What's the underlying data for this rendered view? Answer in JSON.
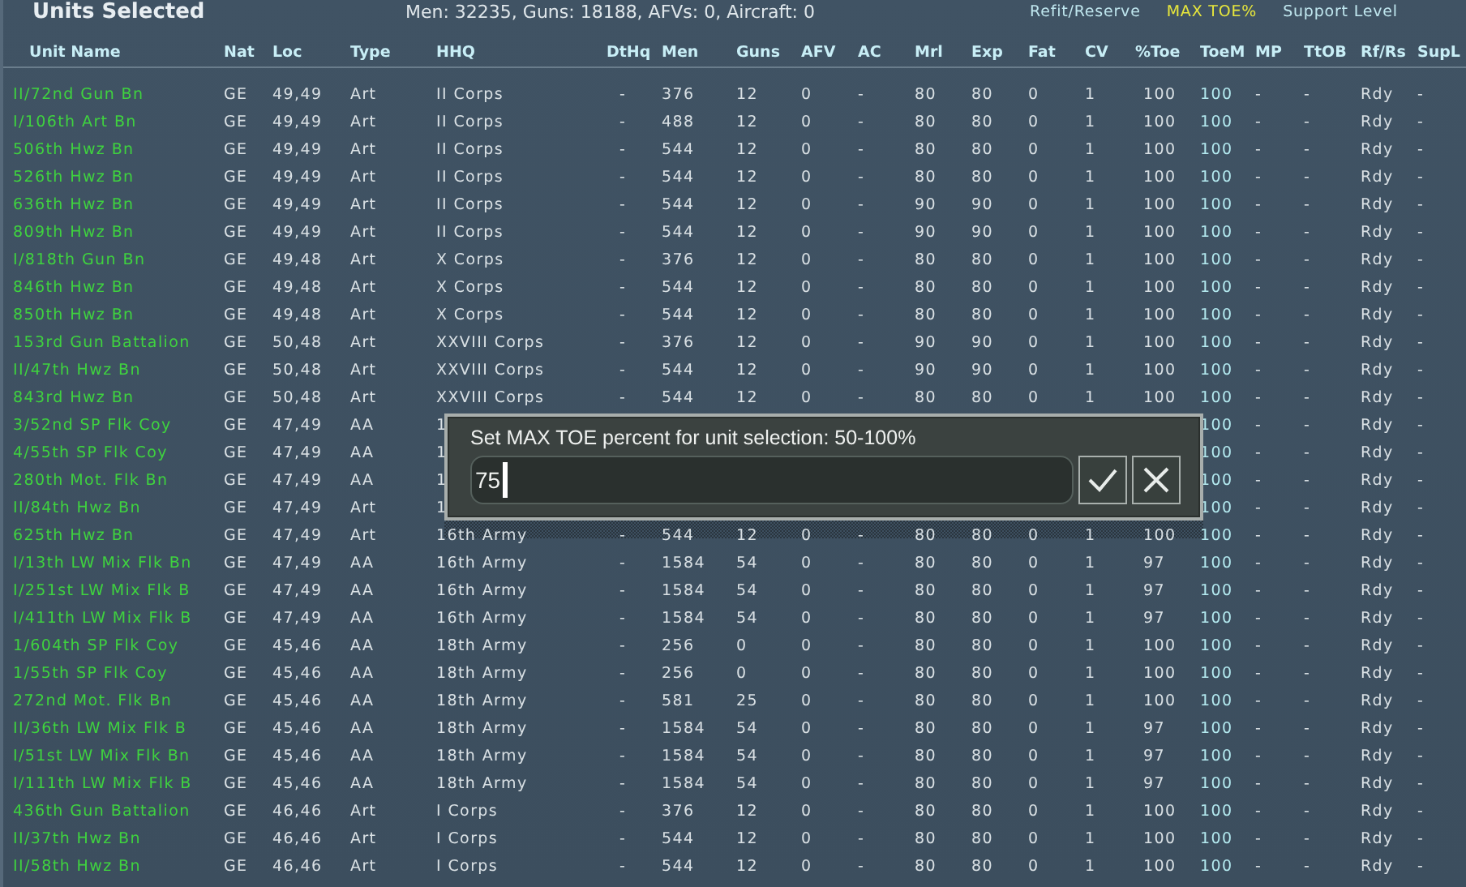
{
  "header": {
    "title": "Units Selected",
    "stats": "Men: 32235, Guns: 18188, AFVs: 0, Aircraft: 0",
    "toggles": [
      {
        "label": "Refit/Reserve",
        "selected": false
      },
      {
        "label": "MAX TOE%",
        "selected": true
      },
      {
        "label": "Support Level",
        "selected": false
      }
    ]
  },
  "table": {
    "columns": [
      "Unit Name",
      "Nat",
      "Loc",
      "Type",
      "HHQ",
      "DtHq",
      "Men",
      "Guns",
      "AFV",
      "AC",
      "Mrl",
      "Exp",
      "Fat",
      "CV",
      "%Toe",
      "ToeM",
      "MP",
      "TtOB",
      "Rf/Rs",
      "SupL"
    ],
    "rows": [
      {
        "cells": [
          "II/72nd Gun Bn",
          "GE",
          "49,49",
          "Art",
          "II Corps",
          "-",
          "376",
          "12",
          "0",
          "-",
          "80",
          "80",
          "0",
          "1",
          "100",
          "100",
          "-",
          "-",
          "Rdy",
          "-"
        ]
      },
      {
        "cells": [
          "I/106th Art Bn",
          "GE",
          "49,49",
          "Art",
          "II Corps",
          "-",
          "488",
          "12",
          "0",
          "-",
          "80",
          "80",
          "0",
          "1",
          "100",
          "100",
          "-",
          "-",
          "Rdy",
          "-"
        ]
      },
      {
        "cells": [
          "506th Hwz Bn",
          "GE",
          "49,49",
          "Art",
          "II Corps",
          "-",
          "544",
          "12",
          "0",
          "-",
          "80",
          "80",
          "0",
          "1",
          "100",
          "100",
          "-",
          "-",
          "Rdy",
          "-"
        ]
      },
      {
        "cells": [
          "526th Hwz Bn",
          "GE",
          "49,49",
          "Art",
          "II Corps",
          "-",
          "544",
          "12",
          "0",
          "-",
          "80",
          "80",
          "0",
          "1",
          "100",
          "100",
          "-",
          "-",
          "Rdy",
          "-"
        ]
      },
      {
        "cells": [
          "636th Hwz Bn",
          "GE",
          "49,49",
          "Art",
          "II Corps",
          "-",
          "544",
          "12",
          "0",
          "-",
          "90",
          "90",
          "0",
          "1",
          "100",
          "100",
          "-",
          "-",
          "Rdy",
          "-"
        ]
      },
      {
        "cells": [
          "809th Hwz Bn",
          "GE",
          "49,49",
          "Art",
          "II Corps",
          "-",
          "544",
          "12",
          "0",
          "-",
          "90",
          "90",
          "0",
          "1",
          "100",
          "100",
          "-",
          "-",
          "Rdy",
          "-"
        ]
      },
      {
        "cells": [
          "I/818th Gun Bn",
          "GE",
          "49,48",
          "Art",
          "X Corps",
          "-",
          "376",
          "12",
          "0",
          "-",
          "80",
          "80",
          "0",
          "1",
          "100",
          "100",
          "-",
          "-",
          "Rdy",
          "-"
        ]
      },
      {
        "cells": [
          "846th Hwz Bn",
          "GE",
          "49,48",
          "Art",
          "X Corps",
          "-",
          "544",
          "12",
          "0",
          "-",
          "80",
          "80",
          "0",
          "1",
          "100",
          "100",
          "-",
          "-",
          "Rdy",
          "-"
        ]
      },
      {
        "cells": [
          "850th Hwz Bn",
          "GE",
          "49,48",
          "Art",
          "X Corps",
          "-",
          "544",
          "12",
          "0",
          "-",
          "80",
          "80",
          "0",
          "1",
          "100",
          "100",
          "-",
          "-",
          "Rdy",
          "-"
        ]
      },
      {
        "cells": [
          "153rd Gun Battalion",
          "GE",
          "50,48",
          "Art",
          "XXVIII Corps",
          "-",
          "376",
          "12",
          "0",
          "-",
          "90",
          "90",
          "0",
          "1",
          "100",
          "100",
          "-",
          "-",
          "Rdy",
          "-"
        ]
      },
      {
        "cells": [
          "II/47th Hwz Bn",
          "GE",
          "50,48",
          "Art",
          "XXVIII Corps",
          "-",
          "544",
          "12",
          "0",
          "-",
          "90",
          "90",
          "0",
          "1",
          "100",
          "100",
          "-",
          "-",
          "Rdy",
          "-"
        ]
      },
      {
        "cells": [
          "843rd Hwz Bn",
          "GE",
          "50,48",
          "Art",
          "XXVIII Corps",
          "-",
          "544",
          "12",
          "0",
          "-",
          "80",
          "80",
          "0",
          "1",
          "100",
          "100",
          "-",
          "-",
          "Rdy",
          "-"
        ]
      },
      {
        "cells": [
          "3/52nd SP Flk Coy",
          "GE",
          "47,49",
          "AA",
          "1"
        ],
        "tail_cells": [
          "100",
          "-",
          "-",
          "Rdy",
          "-"
        ]
      },
      {
        "cells": [
          "4/55th SP Flk Coy",
          "GE",
          "47,49",
          "AA",
          "1"
        ],
        "tail_cells": [
          "100",
          "-",
          "-",
          "Rdy",
          "-"
        ]
      },
      {
        "cells": [
          "280th Mot. Flk Bn",
          "GE",
          "47,49",
          "AA",
          "1"
        ],
        "tail_cells": [
          "100",
          "-",
          "-",
          "Rdy",
          "-"
        ]
      },
      {
        "cells": [
          "II/84th Hwz Bn",
          "GE",
          "47,49",
          "Art",
          "1"
        ],
        "tail_cells": [
          "100",
          "-",
          "-",
          "Rdy",
          "-"
        ]
      },
      {
        "cells": [
          "625th Hwz Bn",
          "GE",
          "47,49",
          "Art",
          "16th Army",
          "-",
          "544",
          "12",
          "0",
          "-",
          "80",
          "80",
          "0",
          "1",
          "100",
          "100",
          "-",
          "-",
          "Rdy",
          "-"
        ]
      },
      {
        "cells": [
          "I/13th LW Mix Flk Bn",
          "GE",
          "47,49",
          "AA",
          "16th Army",
          "-",
          "1584",
          "54",
          "0",
          "-",
          "80",
          "80",
          "0",
          "1",
          "97",
          "100",
          "-",
          "-",
          "Rdy",
          "-"
        ]
      },
      {
        "cells": [
          "I/251st LW Mix Flk B",
          "GE",
          "47,49",
          "AA",
          "16th Army",
          "-",
          "1584",
          "54",
          "0",
          "-",
          "80",
          "80",
          "0",
          "1",
          "97",
          "100",
          "-",
          "-",
          "Rdy",
          "-"
        ]
      },
      {
        "cells": [
          "I/411th LW Mix Flk B",
          "GE",
          "47,49",
          "AA",
          "16th Army",
          "-",
          "1584",
          "54",
          "0",
          "-",
          "80",
          "80",
          "0",
          "1",
          "97",
          "100",
          "-",
          "-",
          "Rdy",
          "-"
        ]
      },
      {
        "cells": [
          "1/604th SP Flk Coy",
          "GE",
          "45,46",
          "AA",
          "18th Army",
          "-",
          "256",
          "0",
          "0",
          "-",
          "80",
          "80",
          "0",
          "1",
          "100",
          "100",
          "-",
          "-",
          "Rdy",
          "-"
        ]
      },
      {
        "cells": [
          "1/55th SP Flk Coy",
          "GE",
          "45,46",
          "AA",
          "18th Army",
          "-",
          "256",
          "0",
          "0",
          "-",
          "80",
          "80",
          "0",
          "1",
          "100",
          "100",
          "-",
          "-",
          "Rdy",
          "-"
        ]
      },
      {
        "cells": [
          "272nd Mot. Flk Bn",
          "GE",
          "45,46",
          "AA",
          "18th Army",
          "-",
          "581",
          "25",
          "0",
          "-",
          "80",
          "80",
          "0",
          "1",
          "100",
          "100",
          "-",
          "-",
          "Rdy",
          "-"
        ]
      },
      {
        "cells": [
          "II/36th LW Mix Flk B",
          "GE",
          "45,46",
          "AA",
          "18th Army",
          "-",
          "1584",
          "54",
          "0",
          "-",
          "80",
          "80",
          "0",
          "1",
          "97",
          "100",
          "-",
          "-",
          "Rdy",
          "-"
        ]
      },
      {
        "cells": [
          "I/51st LW Mix Flk Bn",
          "GE",
          "45,46",
          "AA",
          "18th Army",
          "-",
          "1584",
          "54",
          "0",
          "-",
          "80",
          "80",
          "0",
          "1",
          "97",
          "100",
          "-",
          "-",
          "Rdy",
          "-"
        ]
      },
      {
        "cells": [
          "I/111th LW Mix Flk B",
          "GE",
          "45,46",
          "AA",
          "18th Army",
          "-",
          "1584",
          "54",
          "0",
          "-",
          "80",
          "80",
          "0",
          "1",
          "97",
          "100",
          "-",
          "-",
          "Rdy",
          "-"
        ]
      },
      {
        "cells": [
          "436th Gun Battalion",
          "GE",
          "46,46",
          "Art",
          "I Corps",
          "-",
          "376",
          "12",
          "0",
          "-",
          "80",
          "80",
          "0",
          "1",
          "100",
          "100",
          "-",
          "-",
          "Rdy",
          "-"
        ]
      },
      {
        "cells": [
          "II/37th Hwz Bn",
          "GE",
          "46,46",
          "Art",
          "I Corps",
          "-",
          "544",
          "12",
          "0",
          "-",
          "80",
          "80",
          "0",
          "1",
          "100",
          "100",
          "-",
          "-",
          "Rdy",
          "-"
        ]
      },
      {
        "cells": [
          "II/58th Hwz Bn",
          "GE",
          "46,46",
          "Art",
          "I Corps",
          "-",
          "544",
          "12",
          "0",
          "-",
          "80",
          "80",
          "0",
          "1",
          "100",
          "100",
          "-",
          "-",
          "Rdy",
          "-"
        ]
      }
    ]
  },
  "dialog": {
    "prompt": "Set MAX TOE percent for unit selection: 50-100%",
    "value": "75"
  }
}
